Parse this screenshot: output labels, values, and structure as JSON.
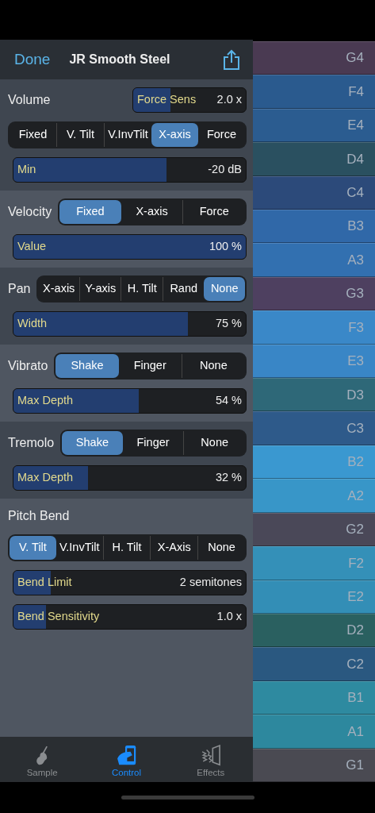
{
  "header": {
    "done": "Done",
    "title": "JR Smooth Steel"
  },
  "sections": [
    {
      "kind": "stacked",
      "title": "Volume",
      "header_slider": {
        "label": "Force Sens",
        "value": "2.0 x",
        "level": 0.33
      },
      "segments": [
        {
          "label": "Fixed",
          "selected": false
        },
        {
          "label": "V. Tilt",
          "selected": false
        },
        {
          "label": "V.InvTilt",
          "selected": false
        },
        {
          "label": "X-axis",
          "selected": true
        },
        {
          "label": "Force",
          "selected": false
        }
      ],
      "sliders": [
        {
          "label": "Min",
          "value": "-20 dB",
          "level": 0.66
        }
      ]
    },
    {
      "kind": "inline",
      "title": "Velocity",
      "segments": [
        {
          "label": "Fixed",
          "selected": true
        },
        {
          "label": "X-axis",
          "selected": false
        },
        {
          "label": "Force",
          "selected": false
        }
      ],
      "sliders": [
        {
          "label": "Value",
          "value": "100 %",
          "level": 1.0
        }
      ]
    },
    {
      "kind": "inline",
      "title": "Pan",
      "segments": [
        {
          "label": "X-axis",
          "selected": false
        },
        {
          "label": "Y-axis",
          "selected": false
        },
        {
          "label": "H. Tilt",
          "selected": false
        },
        {
          "label": "Rand",
          "selected": false
        },
        {
          "label": "None",
          "selected": true
        }
      ],
      "sliders": [
        {
          "label": "Width",
          "value": "75 %",
          "level": 0.75
        }
      ]
    },
    {
      "kind": "inline",
      "title": "Vibrato",
      "segments": [
        {
          "label": "Shake",
          "selected": true
        },
        {
          "label": "Finger",
          "selected": false
        },
        {
          "label": "None",
          "selected": false
        }
      ],
      "sliders": [
        {
          "label": "Max Depth",
          "value": "54 %",
          "level": 0.54
        }
      ]
    },
    {
      "kind": "inline",
      "title": "Tremolo",
      "segments": [
        {
          "label": "Shake",
          "selected": true
        },
        {
          "label": "Finger",
          "selected": false
        },
        {
          "label": "None",
          "selected": false
        }
      ],
      "sliders": [
        {
          "label": "Max Depth",
          "value": "32 %",
          "level": 0.32
        }
      ]
    },
    {
      "kind": "stacked",
      "title": "Pitch Bend",
      "segments": [
        {
          "label": "V. Tilt",
          "selected": true
        },
        {
          "label": "V.InvTilt",
          "selected": false
        },
        {
          "label": "H. Tilt",
          "selected": false
        },
        {
          "label": "X-Axis",
          "selected": false
        },
        {
          "label": "None",
          "selected": false
        }
      ],
      "sliders": [
        {
          "label": "Bend Limit",
          "value": "2 semitones",
          "level": 0.16
        },
        {
          "label": "Bend Sensitivity",
          "value": "1.0 x",
          "level": 0.14
        }
      ]
    }
  ],
  "tab_bar": [
    {
      "kind": "violin",
      "label": "Sample",
      "selected": false
    },
    {
      "kind": "phone",
      "label": "Control",
      "selected": true
    },
    {
      "kind": "effects",
      "label": "Effects",
      "selected": false
    }
  ],
  "keys": [
    {
      "label": "G4",
      "color": "#4a3a52"
    },
    {
      "label": "F4",
      "color": "#2a5a8e"
    },
    {
      "label": "E4",
      "color": "#2b5c90"
    },
    {
      "label": "D4",
      "color": "#2a5060"
    },
    {
      "label": "C4",
      "color": "#2c4a7a"
    },
    {
      "label": "B3",
      "color": "#3068a8"
    },
    {
      "label": "A3",
      "color": "#3270b0"
    },
    {
      "label": "G3",
      "color": "#4e4060"
    },
    {
      "label": "F3",
      "color": "#3a88c8"
    },
    {
      "label": "E3",
      "color": "#3986c6"
    },
    {
      "label": "D3",
      "color": "#2e6878"
    },
    {
      "label": "C3",
      "color": "#2e5a8a"
    },
    {
      "label": "B2",
      "color": "#3a98d0"
    },
    {
      "label": "A2",
      "color": "#3896c8"
    },
    {
      "label": "G2",
      "color": "#4a4858"
    },
    {
      "label": "F2",
      "color": "#3490b8"
    },
    {
      "label": "E2",
      "color": "#338eb6"
    },
    {
      "label": "D2",
      "color": "#2a6060"
    },
    {
      "label": "C2",
      "color": "#2a5880"
    },
    {
      "label": "B1",
      "color": "#2e8aa0"
    },
    {
      "label": "A1",
      "color": "#2d889e"
    },
    {
      "label": "G1",
      "color": "#4a4a52"
    }
  ]
}
